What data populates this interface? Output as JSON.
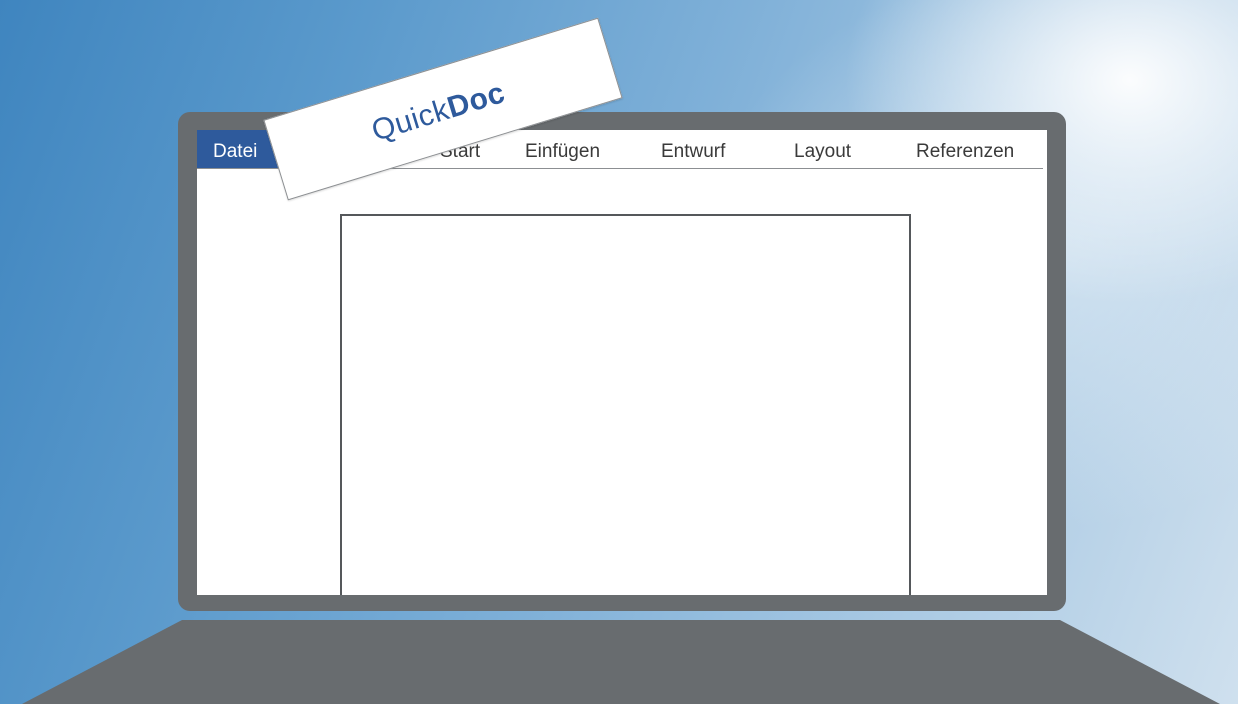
{
  "app": {
    "logo_light": "Quick",
    "logo_bold": "Doc"
  },
  "ribbon": {
    "file_tab": "Datei",
    "tabs": [
      "Start",
      "Einfügen",
      "Entwurf",
      "Layout",
      "Referenzen"
    ]
  },
  "colors": {
    "accent": "#2e5a9c",
    "frame": "#686c6f"
  }
}
